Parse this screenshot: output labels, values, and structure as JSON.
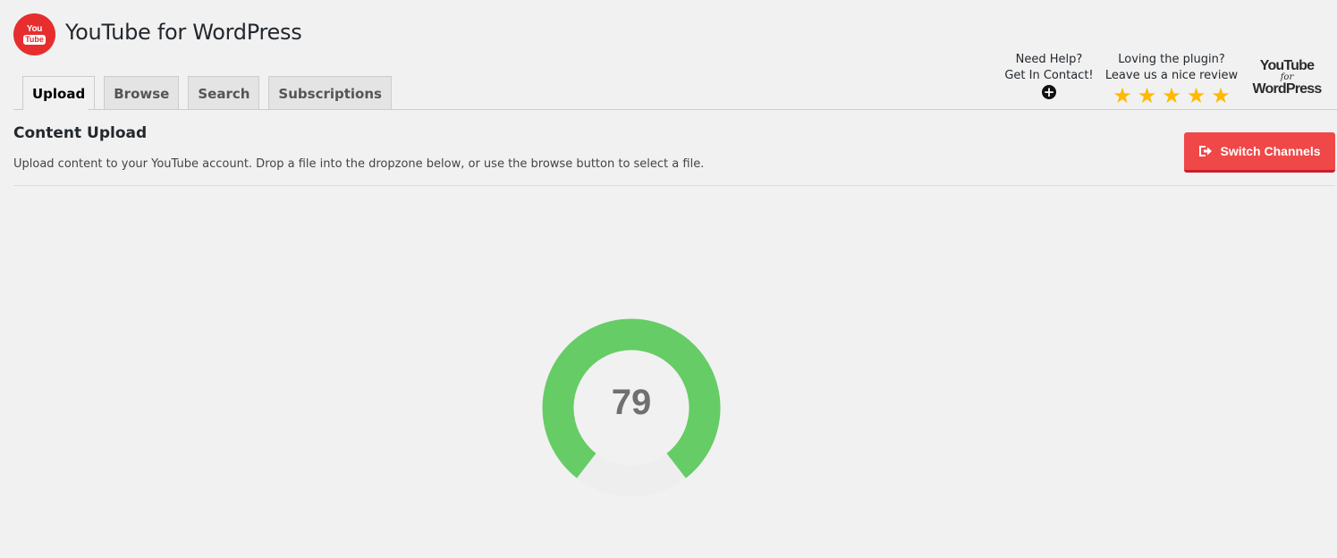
{
  "app": {
    "logo_line1": "You",
    "logo_line2": "Tube",
    "title": "YouTube for WordPress"
  },
  "tabs": [
    {
      "label": "Upload",
      "active": true
    },
    {
      "label": "Browse",
      "active": false
    },
    {
      "label": "Search",
      "active": false
    },
    {
      "label": "Subscriptions",
      "active": false
    }
  ],
  "help": {
    "line1": "Need Help?",
    "line2": "Get In Contact!",
    "icon": "plus-circle-icon"
  },
  "review": {
    "line1": "Loving the plugin?",
    "line2": "Leave us a nice review",
    "stars": 5,
    "star_color": "#ffb900"
  },
  "brand_logo": {
    "line1": "YouTube",
    "line2": "for",
    "line3": "WordPress"
  },
  "content": {
    "title": "Content Upload",
    "description": "Upload content to your YouTube account. Drop a file into the dropzone below, or use the browse button to select a file."
  },
  "switch_button": {
    "label": "Switch Channels",
    "icon": "sign-out-icon",
    "color": "#f04848"
  },
  "progress": {
    "value": "79",
    "percent": 79,
    "fill_color": "#66cc66",
    "track_color": "#eeeeee"
  }
}
